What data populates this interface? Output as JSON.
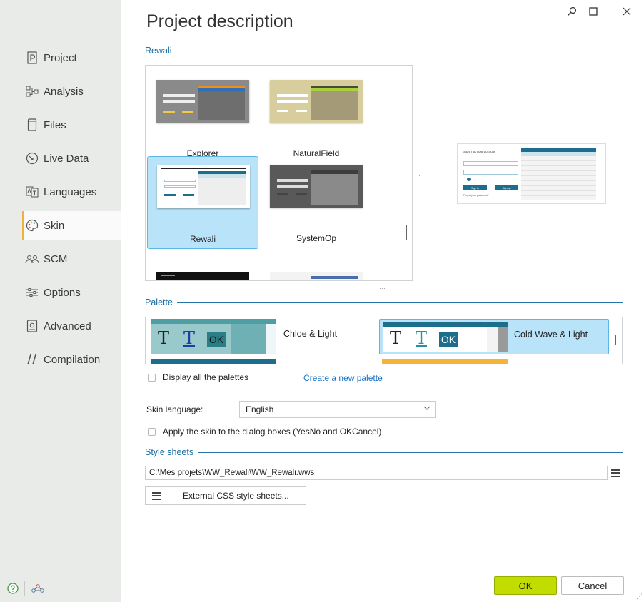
{
  "window": {
    "title": "Project description"
  },
  "sidebar": {
    "items": [
      {
        "label": "Project",
        "icon": "project-icon"
      },
      {
        "label": "Analysis",
        "icon": "analysis-icon"
      },
      {
        "label": "Files",
        "icon": "files-icon"
      },
      {
        "label": "Live Data",
        "icon": "live-data-icon"
      },
      {
        "label": "Languages",
        "icon": "languages-icon"
      },
      {
        "label": "Skin",
        "icon": "skin-palette-icon",
        "active": true
      },
      {
        "label": "SCM",
        "icon": "scm-icon"
      },
      {
        "label": "Options",
        "icon": "options-icon"
      },
      {
        "label": "Advanced",
        "icon": "advanced-icon"
      },
      {
        "label": "Compilation",
        "icon": "compilation-icon"
      }
    ],
    "accent": "#f0b23c"
  },
  "skin_section": {
    "title": "Rewali",
    "skins": [
      {
        "name": "Explorer",
        "colors": {
          "bg": "#8a8a8a",
          "band": "#f08c1e",
          "band2": "#2f70b5"
        }
      },
      {
        "name": "NaturalField",
        "colors": {
          "bg": "#d8cd9d",
          "band": "#a9d13b"
        }
      },
      {
        "name": "Rewali",
        "selected": true,
        "colors": {
          "bg": "#ffffff",
          "band": "#1c6e8c"
        }
      },
      {
        "name": "SystemOp",
        "colors": {
          "bg": "#595959",
          "band": "#3d3d3d"
        }
      }
    ]
  },
  "palette_section": {
    "title": "Palette",
    "palettes": [
      {
        "name": "Chloe & Light",
        "colors": {
          "main": "#6fb0b4",
          "dark": "#2a7f86"
        }
      },
      {
        "name": "Cold Wave & Light",
        "selected": true,
        "colors": {
          "main": "#1c6e8c",
          "dark": "#9a9a9a"
        }
      }
    ],
    "sample_letter": "T",
    "sample_button": "OK",
    "display_all_label": "Display all the palettes",
    "create_link": "Create a new palette"
  },
  "skin_language": {
    "label": "Skin language:",
    "value": "English"
  },
  "apply_dialogs_label": "Apply the skin to the dialog boxes (YesNo and OKCancel)",
  "style_sheets": {
    "title": "Style sheets",
    "path": "C:\\Mes projets\\WW_Rewali\\WW_Rewali.wws",
    "external_button": "External CSS style sheets..."
  },
  "buttons": {
    "ok": "OK",
    "cancel": "Cancel"
  },
  "preview": {
    "title": "Sign into your account",
    "login_button": "Sign in",
    "register_button": "Sign up",
    "forgot_link": "Forgot your password?",
    "accent": "#1c6e8c"
  },
  "colors": {
    "link": "#1a73c8",
    "section": "#1a6fa5",
    "ok_button": "#c2dc00"
  }
}
